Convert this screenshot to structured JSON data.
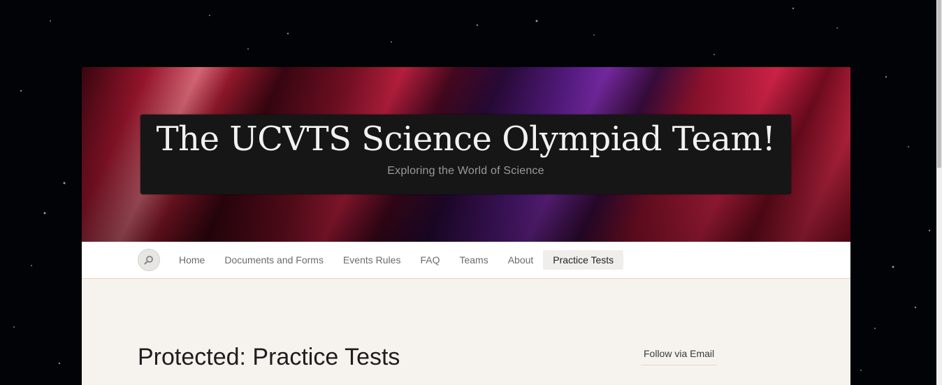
{
  "site": {
    "title": "The UCVTS Science Olympiad Team!",
    "tagline": "Exploring the World of Science"
  },
  "nav": {
    "search_icon": "search-icon",
    "items": [
      {
        "label": "Home"
      },
      {
        "label": "Documents and Forms"
      },
      {
        "label": "Events Rules"
      },
      {
        "label": "FAQ"
      },
      {
        "label": "Teams"
      },
      {
        "label": "About"
      },
      {
        "label": "Practice Tests",
        "active": true
      }
    ]
  },
  "content": {
    "title": "Protected: Practice Tests"
  },
  "sidebar": {
    "widget_title": "Follow via Email"
  },
  "colors": {
    "page_bg": "#f6f3ee",
    "nav_active_bg": "#f0eeeb",
    "accent_border": "#ecd3c7"
  }
}
